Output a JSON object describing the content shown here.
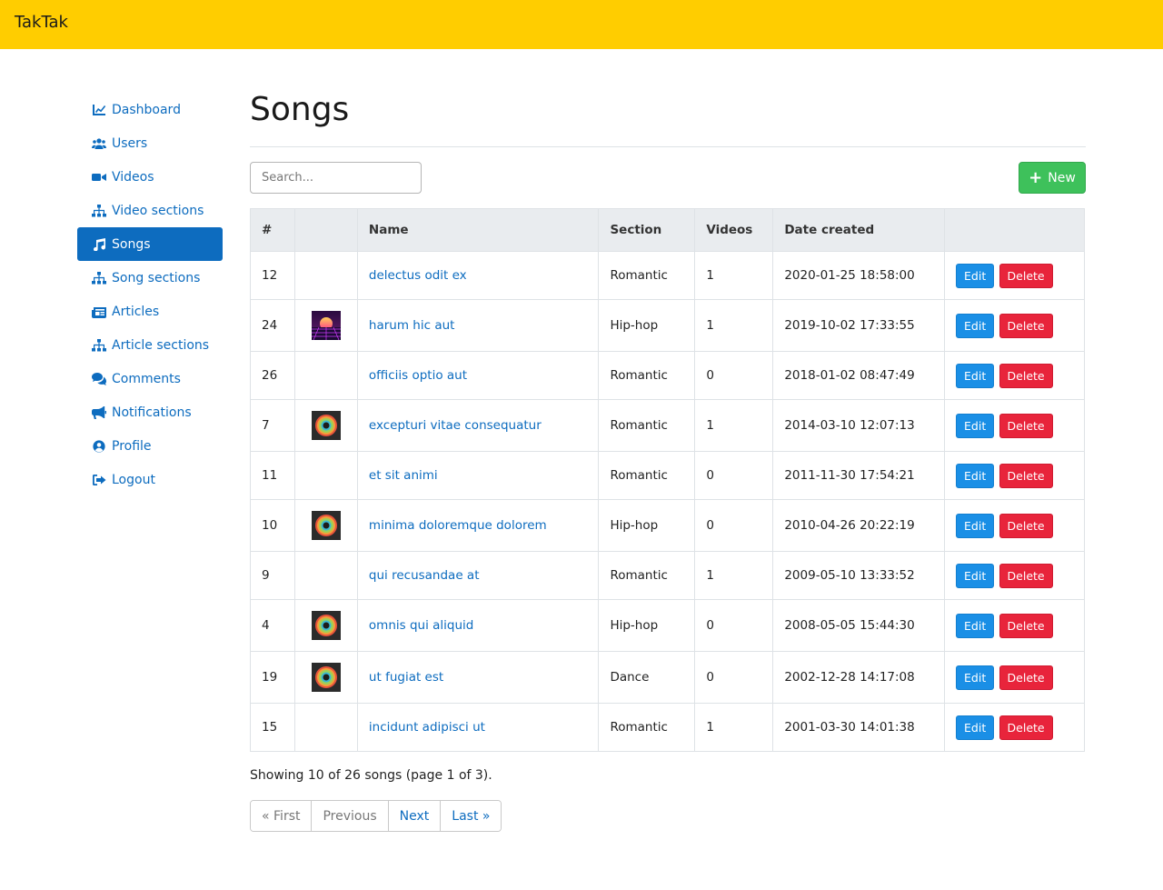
{
  "app": {
    "brand": "TakTak"
  },
  "sidebar": {
    "items": [
      {
        "label": "Dashboard",
        "icon": "chart-line-icon"
      },
      {
        "label": "Users",
        "icon": "users-icon"
      },
      {
        "label": "Videos",
        "icon": "video-camera-icon"
      },
      {
        "label": "Video sections",
        "icon": "sitemap-icon"
      },
      {
        "label": "Songs",
        "icon": "music-icon",
        "active": true
      },
      {
        "label": "Song sections",
        "icon": "sitemap-icon"
      },
      {
        "label": "Articles",
        "icon": "newspaper-icon"
      },
      {
        "label": "Article sections",
        "icon": "sitemap-icon"
      },
      {
        "label": "Comments",
        "icon": "comments-icon"
      },
      {
        "label": "Notifications",
        "icon": "bullhorn-icon"
      },
      {
        "label": "Profile",
        "icon": "user-circle-icon"
      },
      {
        "label": "Logout",
        "icon": "sign-out-icon"
      }
    ]
  },
  "main": {
    "title": "Songs",
    "search_placeholder": "Search...",
    "new_label": "New"
  },
  "table": {
    "headers": [
      "#",
      "",
      "Name",
      "Section",
      "Videos",
      "Date created",
      ""
    ],
    "edit_label": "Edit",
    "delete_label": "Delete",
    "rows": [
      {
        "id": "12",
        "cover": "",
        "name": "delectus odit ex",
        "section": "Romantic",
        "videos": "1",
        "date": "2020-01-25 18:58:00"
      },
      {
        "id": "24",
        "cover": "synthwave-sunset-thumbnail",
        "name": "harum hic aut",
        "section": "Hip-hop",
        "videos": "1",
        "date": "2019-10-02 17:33:55"
      },
      {
        "id": "26",
        "cover": "",
        "name": "officiis optio aut",
        "section": "Romantic",
        "videos": "0",
        "date": "2018-01-02 08:47:49"
      },
      {
        "id": "7",
        "cover": "rainbow-ring-thumbnail",
        "name": "excepturi vitae consequatur",
        "section": "Romantic",
        "videos": "1",
        "date": "2014-03-10 12:07:13"
      },
      {
        "id": "11",
        "cover": "",
        "name": "et sit animi",
        "section": "Romantic",
        "videos": "0",
        "date": "2011-11-30 17:54:21"
      },
      {
        "id": "10",
        "cover": "rainbow-ring-thumbnail",
        "name": "minima doloremque dolorem",
        "section": "Hip-hop",
        "videos": "0",
        "date": "2010-04-26 20:22:19"
      },
      {
        "id": "9",
        "cover": "",
        "name": "qui recusandae at",
        "section": "Romantic",
        "videos": "1",
        "date": "2009-05-10 13:33:52"
      },
      {
        "id": "4",
        "cover": "rainbow-ring-thumbnail",
        "name": "omnis qui aliquid",
        "section": "Hip-hop",
        "videos": "0",
        "date": "2008-05-05 15:44:30"
      },
      {
        "id": "19",
        "cover": "rainbow-ring-thumbnail",
        "name": "ut fugiat est",
        "section": "Dance",
        "videos": "0",
        "date": "2002-12-28 14:17:08"
      },
      {
        "id": "15",
        "cover": "",
        "name": "incidunt adipisci ut",
        "section": "Romantic",
        "videos": "1",
        "date": "2001-03-30 14:01:38"
      }
    ]
  },
  "footer": {
    "showing": "Showing 10 of 26 songs (page 1 of 3).",
    "pagination": [
      {
        "label": "« First",
        "enabled": false
      },
      {
        "label": "Previous",
        "enabled": false
      },
      {
        "label": "Next",
        "enabled": true
      },
      {
        "label": "Last »",
        "enabled": true
      }
    ]
  },
  "colors": {
    "topbar": "#ffcd00",
    "link": "#0d6cbf",
    "new_button": "#3ec15b",
    "edit_button": "#1a8fe6",
    "delete_button": "#e8243b"
  }
}
